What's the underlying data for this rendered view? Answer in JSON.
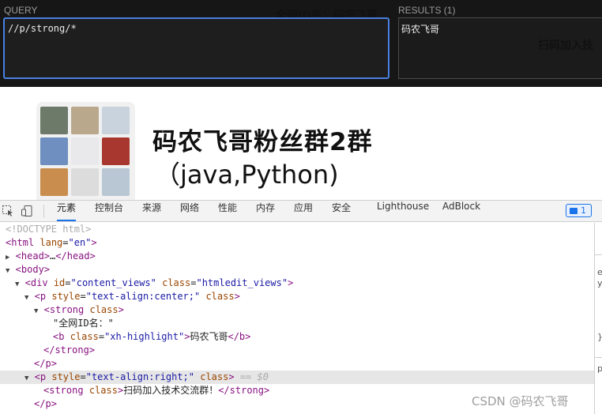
{
  "xpath_helper": {
    "query_label": "QUERY",
    "query_value": "//p/strong/*",
    "results_label": "RESULTS (1)",
    "results_value": "码农飞哥",
    "behind_text_1": "全网ID名：码农飞哥",
    "behind_text_2": "扫码加入技"
  },
  "page": {
    "title_line1": "码农飞哥粉丝群2群",
    "title_line2": "（java,Python)",
    "qr_tiles": [
      "#6d7a6a",
      "#b9a88c",
      "#c8d3de",
      "#6e8fbf",
      "#e9e9ec",
      "#a7372f",
      "#c98d4d",
      "#dcdcdc",
      "#b8c7d3"
    ]
  },
  "devtools": {
    "tabs": [
      "元素",
      "控制台",
      "来源",
      "网络",
      "性能",
      "内存",
      "应用",
      "安全",
      "Lighthouse",
      "AdBlock"
    ],
    "active_tab": "元素",
    "issues_count": "1",
    "side_text": [
      "e",
      "y",
      "}",
      "p"
    ],
    "watermark": "CSDN @码农飞哥",
    "lines": {
      "doctype": "<!DOCTYPE html>",
      "html_open": "html",
      "html_attr": "lang",
      "html_attr_val": "\"en\"",
      "head": "head",
      "head_ellipsis": "…",
      "body": "body",
      "div_tag": "div",
      "div_id_attr": "id",
      "div_id_val": "\"content_views\"",
      "div_class_attr": "class",
      "div_class_val": "\"htmledit_views\"",
      "p_tag": "p",
      "p_style_attr": "style",
      "p1_style_val": "\"text-align:center;\"",
      "p_class_attr": "class",
      "strong_tag": "strong",
      "strong_class": "class",
      "text_node": "\"全网ID名：\"",
      "b_tag": "b",
      "b_class_attr": "class",
      "b_class_val": "\"xh-highlight\"",
      "b_text": "码农飞哥",
      "p2_style_val": "\"text-align:right;\"",
      "selected_marker": "== $0",
      "strong2_text": "扫码加入技术交流群！"
    }
  }
}
